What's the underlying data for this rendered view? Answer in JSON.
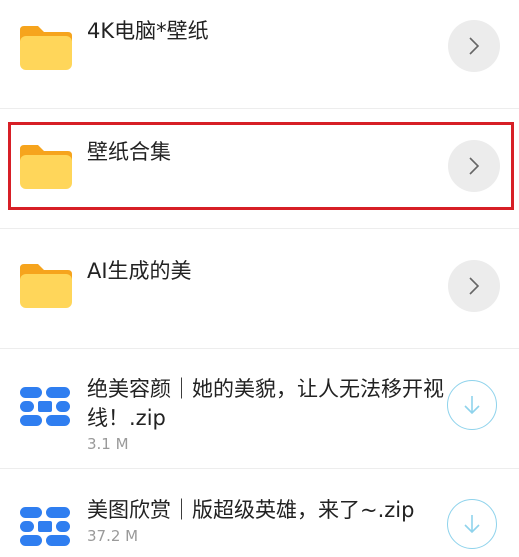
{
  "items": [
    {
      "type": "folder",
      "title": "4K电脑*壁纸"
    },
    {
      "type": "folder",
      "title": "壁纸合集"
    },
    {
      "type": "folder",
      "title": "AI生成的美"
    },
    {
      "type": "file",
      "title": "绝美容颜｜她的美貌，让人无法移开视线！.zip",
      "size": "3.1 M"
    },
    {
      "type": "file",
      "title": "美图欣赏｜版超级英雄，来了~.zip",
      "size": "37.2 M"
    }
  ],
  "colors": {
    "folder_back": "#f6a41d",
    "folder_front": "#ffd65a",
    "archive": "#2f7ef0",
    "highlight": "#d71f26",
    "download_ring": "#8fd3ec"
  }
}
